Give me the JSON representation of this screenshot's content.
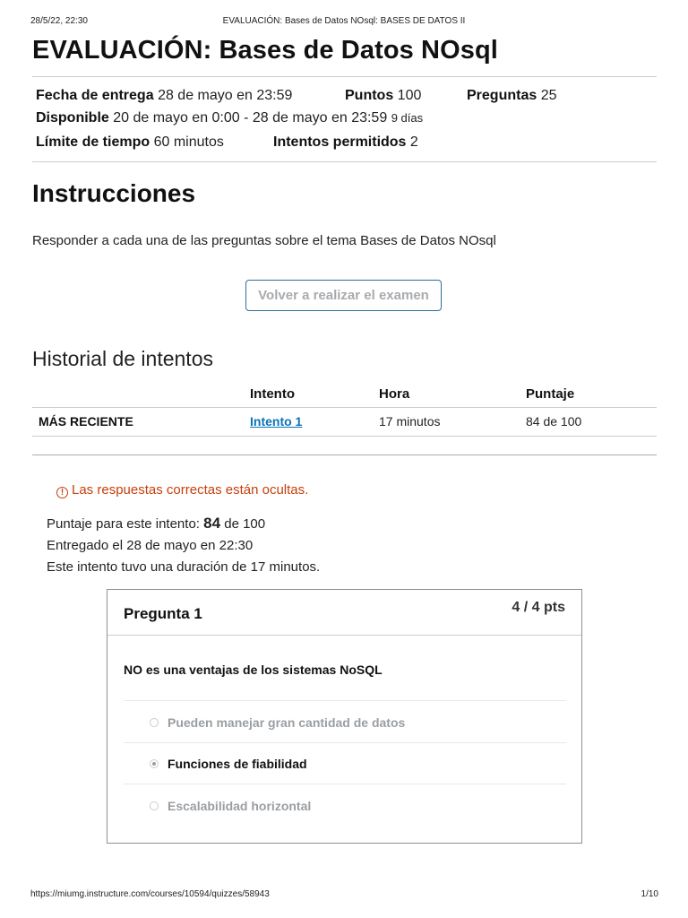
{
  "print": {
    "datetime": "28/5/22, 22:30",
    "header_title": "EVALUACIÓN: Bases de Datos NOsql: BASES DE DATOS II",
    "url": "https://miumg.instructure.com/courses/10594/quizzes/58943",
    "page_number": "1/10"
  },
  "quiz": {
    "title": "EVALUACIÓN: Bases de Datos NOsql",
    "meta": {
      "due_label": "Fecha de entrega",
      "due_value": "28 de mayo en 23:59",
      "points_label": "Puntos",
      "points_value": "100",
      "questions_label": "Preguntas",
      "questions_value": "25",
      "available_label": "Disponible",
      "available_value": "20 de mayo en 0:00 - 28 de mayo en 23:59",
      "available_days": "9 días",
      "time_limit_label": "Límite de tiempo",
      "time_limit_value": "60 minutos",
      "attempts_label": "Intentos permitidos",
      "attempts_value": "2"
    },
    "instructions_heading": "Instrucciones",
    "instructions_text": "Responder a cada una de las preguntas sobre el tema Bases de Datos NOsql",
    "retake_button": "Volver a realizar el examen"
  },
  "history": {
    "heading": "Historial de intentos",
    "columns": [
      "Intento",
      "Hora",
      "Puntaje"
    ],
    "rows": [
      {
        "label": "MÁS RECIENTE",
        "attempt": "Intento 1",
        "time": "17 minutos",
        "score": "84 de 100"
      }
    ]
  },
  "result": {
    "hidden_notice": "Las respuestas correctas están ocultas.",
    "notice_icon": "!",
    "score_prefix": "Puntaje para este intento:",
    "score_value": "84",
    "score_suffix": "de 100",
    "submitted": "Entregado el 28 de mayo en 22:30",
    "duration": "Este intento tuvo una duración de 17 minutos."
  },
  "question": {
    "title": "Pregunta 1",
    "points": "4 / 4 pts",
    "text": "NO es una ventajas de los sistemas NoSQL",
    "answers": [
      {
        "label": "Pueden manejar gran cantidad de datos",
        "selected": false
      },
      {
        "label": "Funciones de fiabilidad",
        "selected": true
      },
      {
        "label": "Escalabilidad horizontal",
        "selected": false
      }
    ]
  },
  "colors": {
    "link": "#0a74b8",
    "warning": "#c63f0b",
    "button_border": "#2d6e97"
  }
}
